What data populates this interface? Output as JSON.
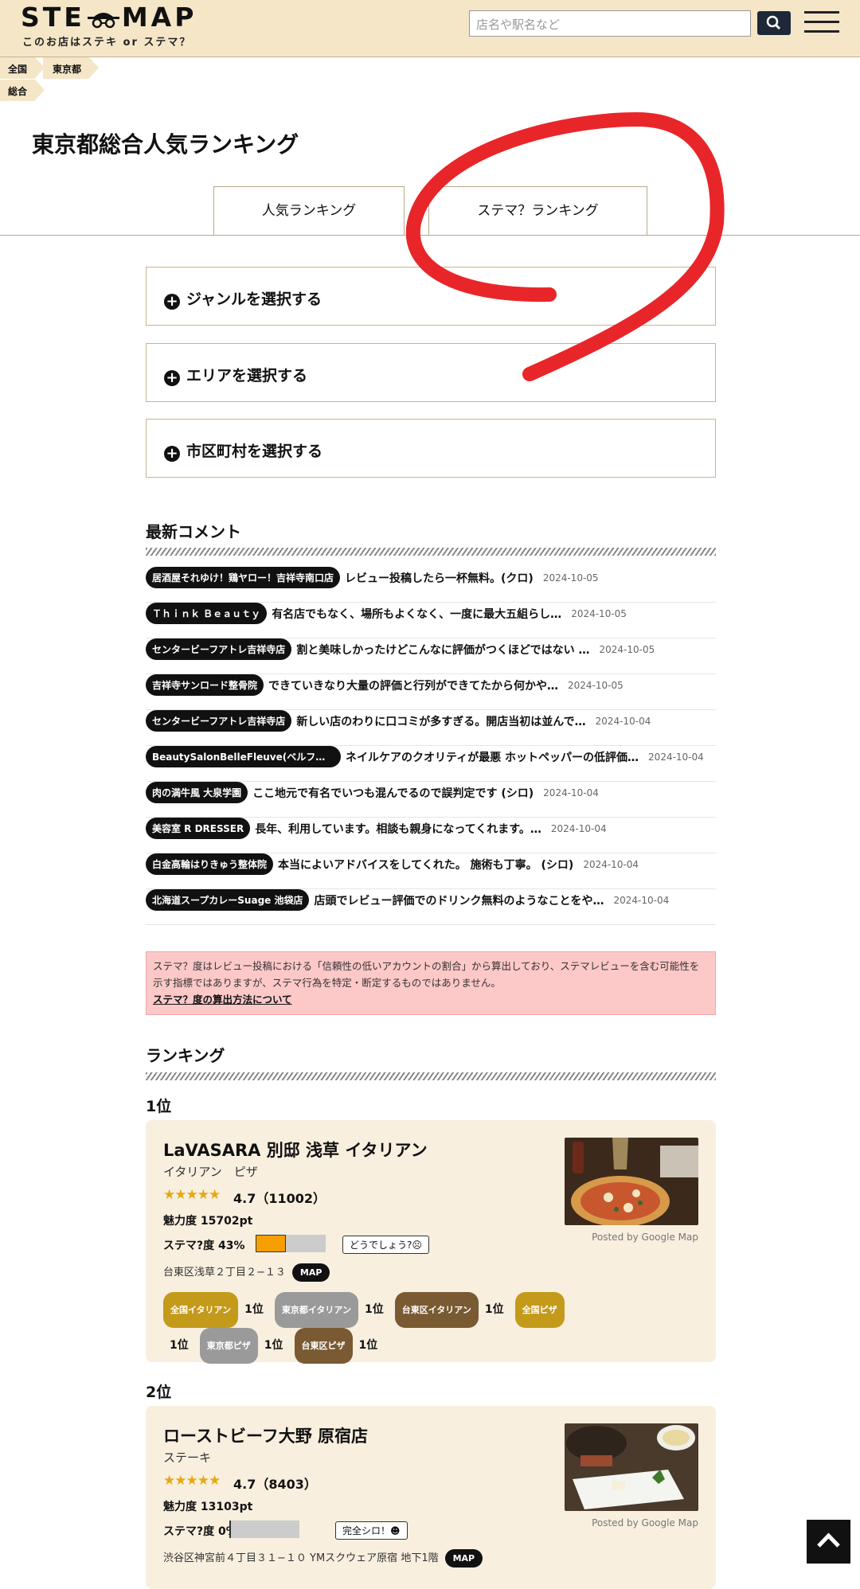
{
  "header": {
    "logo_text_left": "STE",
    "logo_text_right": "MAP",
    "logo_sub": "このお店はステキ or ステマ？",
    "search_placeholder": "店名や駅名など"
  },
  "breadcrumb": [
    "全国",
    "東京都",
    "総合"
  ],
  "page_title": "東京都総合人気ランキング",
  "tabs": [
    {
      "label": "人気ランキング",
      "active": true
    },
    {
      "label": "ステマ？ランキング",
      "active": false
    }
  ],
  "selectors": [
    "ジャンルを選択する",
    "エリアを選択する",
    "市区町村を選択する"
  ],
  "comments_title": "最新コメント",
  "comments": [
    {
      "shop": "居酒屋それゆけ！鶏ヤロー！吉祥寺南口店",
      "text": "レビュー投稿したら一杯無料。(クロ)",
      "date": "2024-10-05"
    },
    {
      "shop": "Ｔｈｉｎｋ Ｂｅａｕｔｙ",
      "text": "有名店でもなく、場所もよくなく、一度に最大五組らし…",
      "date": "2024-10-05"
    },
    {
      "shop": "センタービーフアトレ吉祥寺店",
      "text": "割と美味しかったけどこんなに評価がつくほどではない …",
      "date": "2024-10-05"
    },
    {
      "shop": "吉祥寺サンロード整骨院",
      "text": "できていきなり大量の評価と行列ができてたから何かや…",
      "date": "2024-10-05"
    },
    {
      "shop": "センタービーフアトレ吉祥寺店",
      "text": "新しい店のわりに口コミが多すぎる。開店当初は並んで…",
      "date": "2024-10-04"
    },
    {
      "shop": "BeautySalonBelleFleuve(ベルフルー…",
      "text": "ネイルケアのクオリティが最悪 ホットペッパーの低評価…",
      "date": "2024-10-04"
    },
    {
      "shop": "肉の満牛風 大泉学園",
      "text": "ここ地元で有名でいつも混んでるので誤判定です (シロ)",
      "date": "2024-10-04"
    },
    {
      "shop": "美容室 R DRESSER",
      "text": "長年、利用しています。相談も親身になってくれます。…",
      "date": "2024-10-04"
    },
    {
      "shop": "白金高輪はりきゅう整体院",
      "text": "本当によいアドバイスをしてくれた。 施術も丁寧。 (シロ)",
      "date": "2024-10-04"
    },
    {
      "shop": "北海道スープカレーSuage 池袋店",
      "text": "店頭でレビュー評価でのドリンク無料のようなことをや…",
      "date": "2024-10-04"
    }
  ],
  "notice": {
    "text": "ステマ？度はレビュー投稿における「信頼性の低いアカウントの割合」から算出しており、ステマレビューを含む可能性を示す指標ではありますが、ステマ行為を特定・断定するものではありません。",
    "link": "ステマ？度の算出方法について"
  },
  "ranking_title": "ランキング",
  "rankings": [
    {
      "rank_label": "1位",
      "name": "LaVASARA 別邸 浅草 イタリアン",
      "genre": "イタリアン　ピザ",
      "stars": "★★★★★",
      "rating": "4.7（11002）",
      "charm": "魅力度 15702pt",
      "stema_label": "ステマ?度 43%",
      "stema_value": 0.43,
      "bubble": "どうでしょう?☹",
      "address": "台東区浅草２丁目２−１３",
      "map": "MAP",
      "chips": [
        {
          "label": "全国イタリアン",
          "color": "#c49a1a",
          "rank": "1位"
        },
        {
          "label": "東京都イタリアン",
          "color": "#9a9a9a",
          "rank": "1位"
        },
        {
          "label": "台東区イタリアン",
          "color": "#7a5a32",
          "rank": "1位"
        },
        {
          "label": "全国ピザ",
          "color": "#c49a1a",
          "rank": "1位"
        },
        {
          "label": "東京都ピザ",
          "color": "#9a9a9a",
          "rank": "1位"
        },
        {
          "label": "台東区ピザ",
          "color": "#7a5a32",
          "rank": "1位"
        }
      ],
      "posted": "Posted by Google Map"
    },
    {
      "rank_label": "2位",
      "name": "ローストビーフ大野 原宿店",
      "genre": "ステーキ",
      "stars": "★★★★★",
      "rating": "4.7（8403）",
      "charm": "魅力度 13103pt",
      "stema_label": "ステマ?度 0%",
      "stema_value": 0.0,
      "bubble": "完全シロ！☻",
      "address": "渋谷区神宮前４丁目３１−１０ YMスクウェア原宿 地下1階",
      "map": "MAP",
      "posted": "Posted by Google Map"
    }
  ],
  "colors": {
    "header_bg": "#f5e6c8",
    "accent_red": "#e8262a",
    "card_bg": "#f8efdf",
    "notice_bg": "#fdc8c8"
  }
}
